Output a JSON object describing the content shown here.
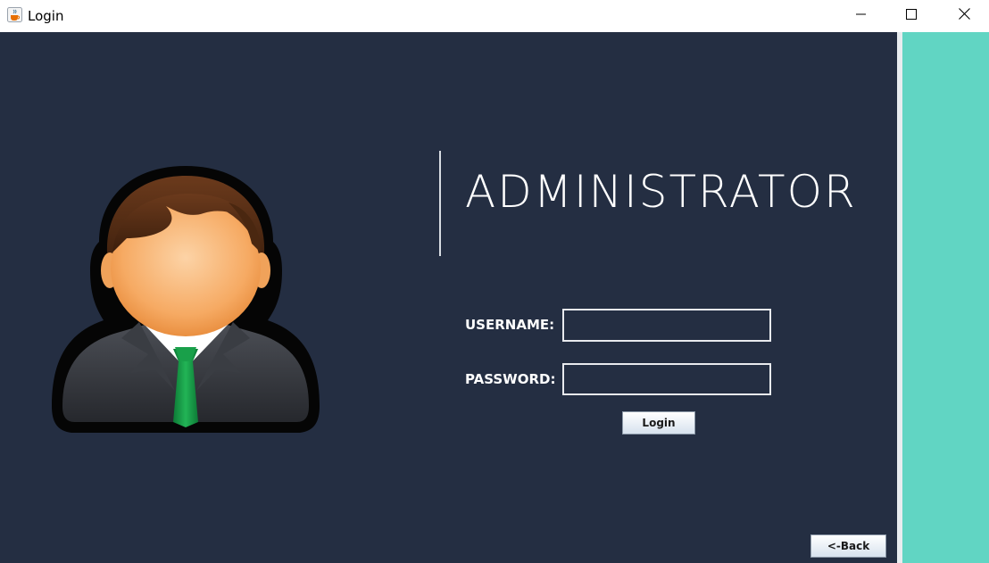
{
  "window": {
    "title": "Login",
    "icon": "java-cup-icon",
    "controls": [
      "minimize-icon",
      "maximize-icon",
      "close-icon"
    ]
  },
  "colors": {
    "background": "#242e42",
    "accent_panel": "#61d5c3",
    "text": "#ffffff"
  },
  "main": {
    "avatar_icon": "administrator-avatar-icon",
    "heading": "ADMINISTRATOR",
    "username_label": "USERNAME:",
    "username_value": "",
    "password_label": "PASSWORD:",
    "password_value": "",
    "login_button": "Login",
    "back_button": "<-Back"
  }
}
